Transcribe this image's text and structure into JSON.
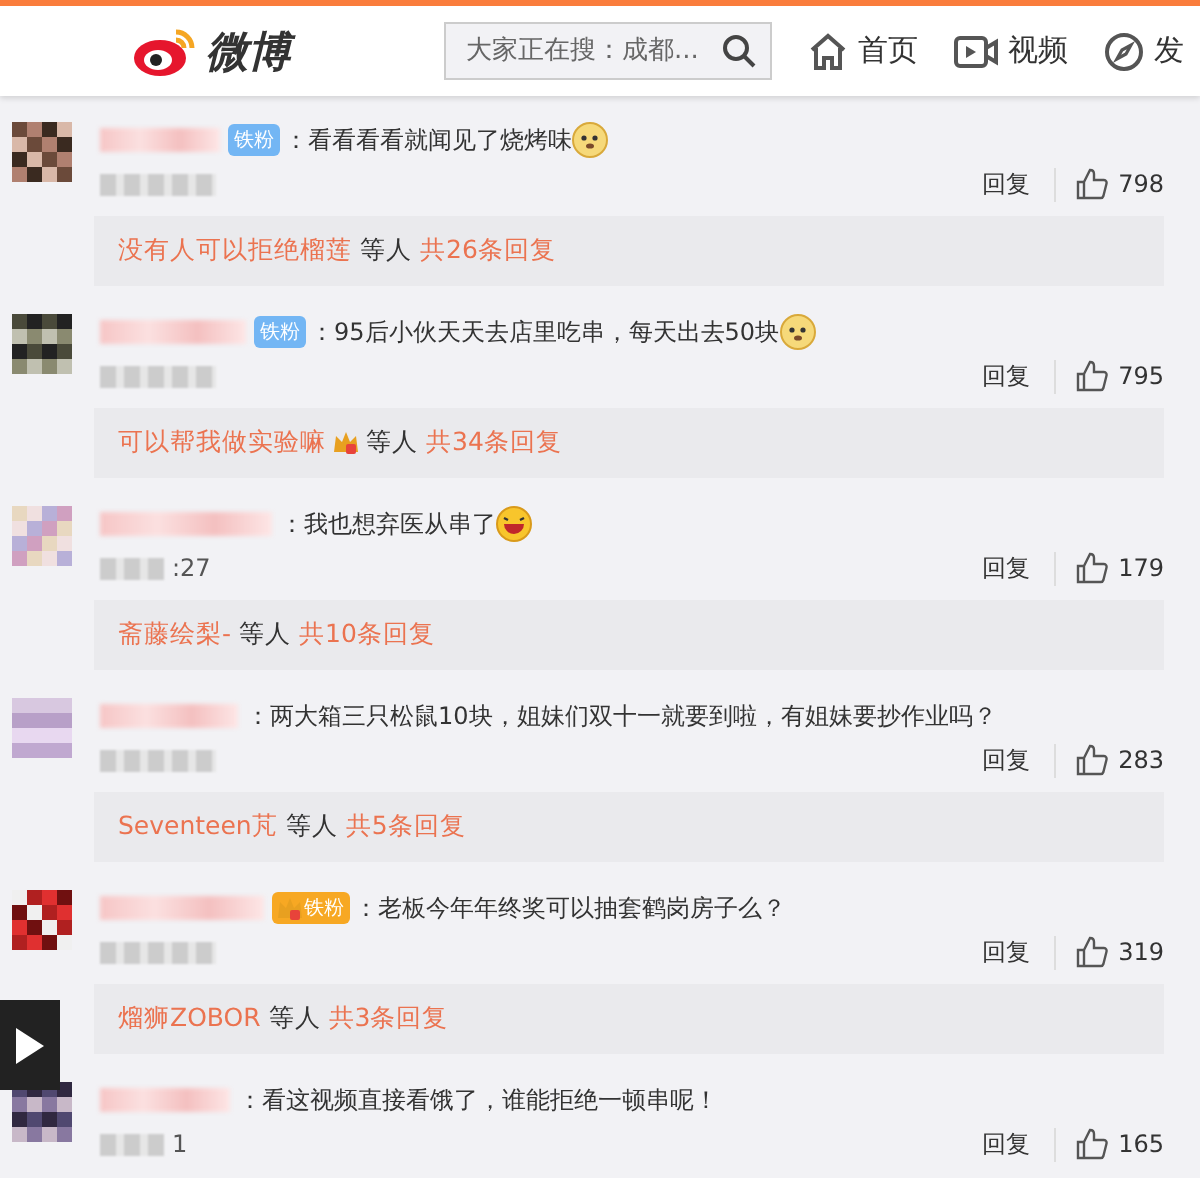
{
  "header": {
    "logo": "微博",
    "search": {
      "placeholder": "大家正在搜：成都..."
    },
    "nav": [
      {
        "label": "首页"
      },
      {
        "label": "视频"
      },
      {
        "label": "发"
      }
    ]
  },
  "comments": [
    {
      "badge": {
        "kind": "fan",
        "label": "铁粉"
      },
      "text": "：看看看看就闻见了烧烤味",
      "emoji": {
        "kind": "doge"
      },
      "reply_label": "回复",
      "likes": "798",
      "replies": {
        "name": "没有人可以拒绝榴莲",
        "crown": false,
        "etc": "等人",
        "count": "共26条回复"
      }
    },
    {
      "badge": {
        "kind": "fan",
        "label": "铁粉"
      },
      "text": "：95后小伙天天去店里吃串，每天出去50块",
      "emoji": {
        "kind": "doge"
      },
      "reply_label": "回复",
      "likes": "795",
      "replies": {
        "name": "可以帮我做实验嘛",
        "crown": true,
        "etc": "等人",
        "count": "共34条回复"
      }
    },
    {
      "text": "：我也想弃医从串了",
      "emoji": {
        "kind": "laugh"
      },
      "time": ":27",
      "reply_label": "回复",
      "likes": "179",
      "replies": {
        "name": "斋藤绘梨-",
        "crown": false,
        "etc": "等人",
        "count": "共10条回复"
      }
    },
    {
      "text": "：两大箱三只松鼠10块，姐妹们双十一就要到啦，有姐妹要抄作业吗？",
      "reply_label": "回复",
      "likes": "283",
      "replies": {
        "name": "Seventeen芃",
        "crown": false,
        "etc": "等人",
        "count": "共5条回复"
      }
    },
    {
      "badge": {
        "kind": "gold",
        "label": "铁粉"
      },
      "text": "：老板今年年终奖可以抽套鹤岗房子么？",
      "reply_label": "回复",
      "likes": "319",
      "replies": {
        "name": "熘狮ZOBOR",
        "crown": false,
        "etc": "等人",
        "count": "共3条回复"
      }
    },
    {
      "text": "：看这视频直接看饿了，谁能拒绝一顿串呢！",
      "time": "1",
      "reply_label": "回复",
      "likes": "165"
    }
  ]
}
